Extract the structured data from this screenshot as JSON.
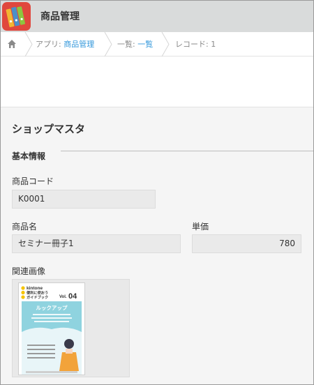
{
  "header": {
    "app_title": "商品管理",
    "app_icon": "binders-icon",
    "app_icon_color": "#e0473d"
  },
  "breadcrumb": {
    "home_icon": "home-icon",
    "app_prefix": "アプリ: ",
    "app_link": "商品管理",
    "list_prefix": "一覧: ",
    "list_link": "一覧",
    "record_text": "レコード: 1",
    "link_color": "#3498db"
  },
  "record": {
    "title": "ショップマスタ",
    "group_label": "基本情報",
    "fields": {
      "product_code": {
        "label": "商品コード",
        "value": "K0001"
      },
      "product_name": {
        "label": "商品名",
        "value": "セミナー冊子1"
      },
      "unit_price": {
        "label": "単価",
        "value": "780"
      },
      "related_image": {
        "label": "関連画像"
      }
    }
  },
  "thumbnail": {
    "line1": "kintone",
    "line2": "便利に使おう",
    "line3": "ガイドブック",
    "vol_label": "Vol.",
    "vol_number": "04",
    "banner": "ルックアップ"
  }
}
